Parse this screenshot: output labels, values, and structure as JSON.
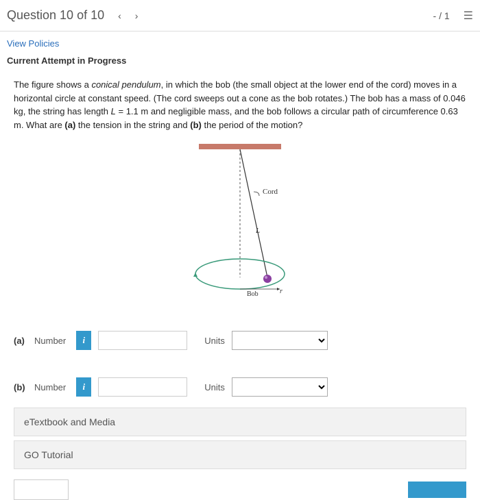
{
  "header": {
    "title": "Question 10 of 10",
    "prev": "‹",
    "next": "›",
    "score": "- / 1",
    "menu": "☰"
  },
  "policies": {
    "link": "View Policies"
  },
  "attempt": "Current Attempt in Progress",
  "question": {
    "text_pre": "The figure shows a ",
    "italic": "conical pendulum",
    "text_mid": ", in which the bob (the small object at the lower end of the cord) moves in a horizontal circle at constant speed. (The cord sweeps out a cone as the bob rotates.) The bob has a mass of 0.046 kg, the string has length ",
    "L_italic": "L",
    "text_after_L": " = 1.1 m and negligible mass, and the bob follows a circular path of circumference 0.63 m. What are ",
    "bold_a": "(a)",
    "text_a": " the tension in the string and ",
    "bold_b": "(b)",
    "text_b": " the period of the motion?"
  },
  "figure": {
    "cord_label": "Cord",
    "L_label": "L",
    "bob_label": "Bob",
    "r_label": "r"
  },
  "answers": {
    "a": {
      "part": "(a)",
      "number_label": "Number",
      "info": "i",
      "units_label": "Units"
    },
    "b": {
      "part": "(b)",
      "number_label": "Number",
      "info": "i",
      "units_label": "Units"
    }
  },
  "resources": {
    "etextbook": "eTextbook and Media",
    "go": "GO Tutorial"
  }
}
